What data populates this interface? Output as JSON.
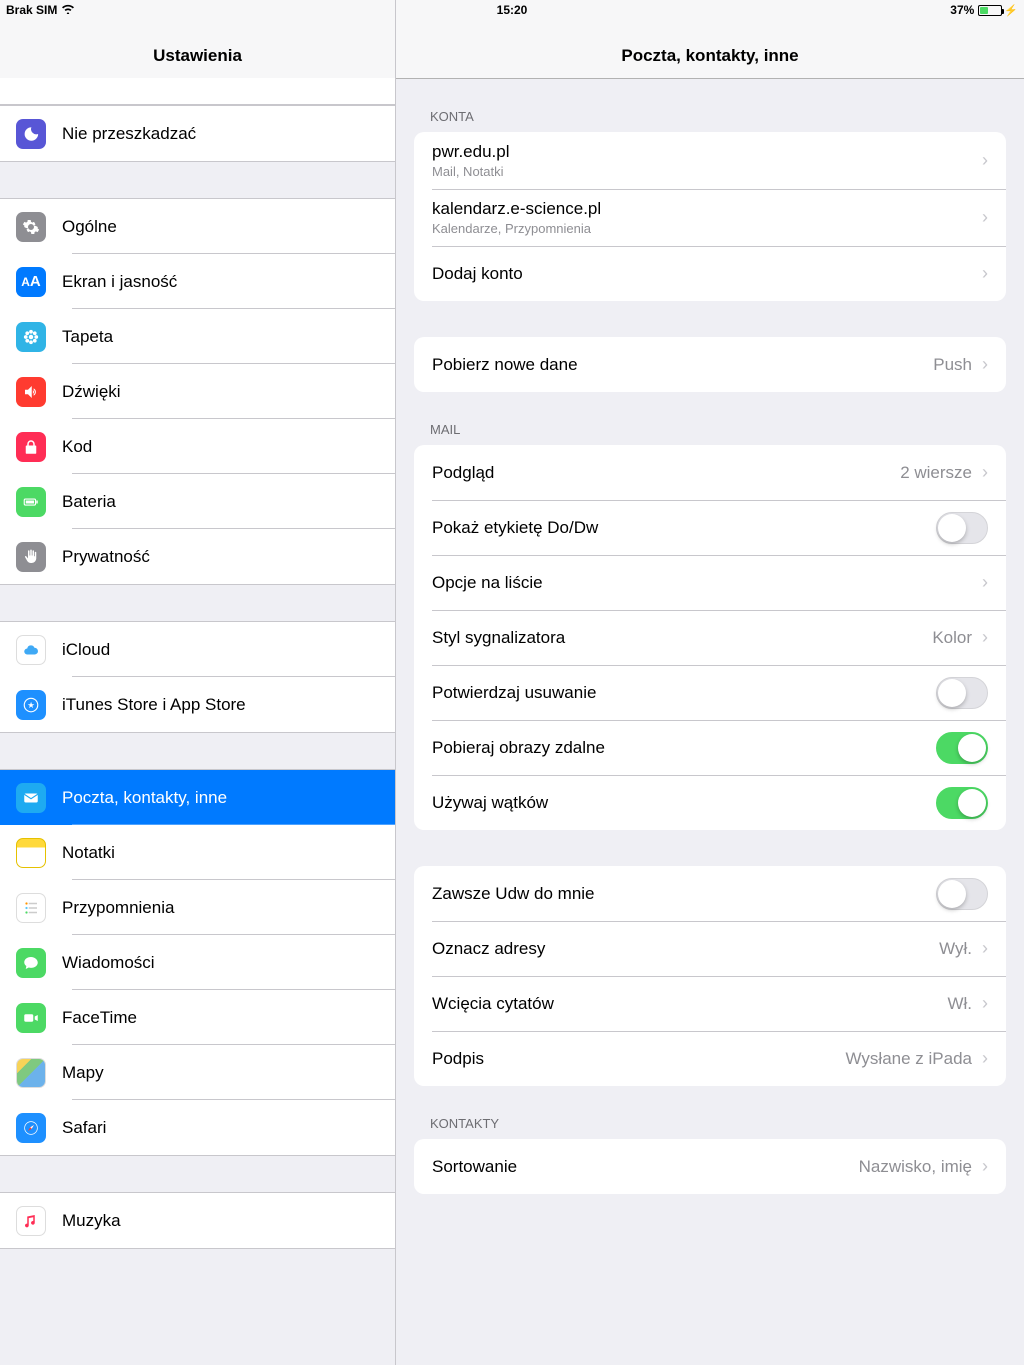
{
  "status": {
    "carrier": "Brak SIM",
    "time": "15:20",
    "battery_pct": "37%"
  },
  "sidebar": {
    "title": "Ustawienia",
    "items": [
      {
        "id": "dnd",
        "label": "Nie przeszkadzać",
        "icon": "moon",
        "bg": "#5856d6"
      },
      {
        "id": "general",
        "label": "Ogólne",
        "icon": "gear",
        "bg": "#8e8e93"
      },
      {
        "id": "display",
        "label": "Ekran i jasność",
        "icon": "AA",
        "bg": "#007aff"
      },
      {
        "id": "wallpaper",
        "label": "Tapeta",
        "icon": "flower",
        "bg": "#55c1ee"
      },
      {
        "id": "sounds",
        "label": "Dźwięki",
        "icon": "volume",
        "bg": "#ff3b30"
      },
      {
        "id": "passcode",
        "label": "Kod",
        "icon": "lock",
        "bg": "#ff2d55"
      },
      {
        "id": "battery",
        "label": "Bateria",
        "icon": "battery",
        "bg": "#4cd964"
      },
      {
        "id": "privacy",
        "label": "Prywatność",
        "icon": "hand",
        "bg": "#8e8e93"
      },
      {
        "id": "icloud",
        "label": "iCloud",
        "icon": "cloud",
        "bg": "#ffffff"
      },
      {
        "id": "itunes",
        "label": "iTunes Store i App Store",
        "icon": "appstore",
        "bg": "#1e90ff"
      },
      {
        "id": "mail",
        "label": "Poczta, kontakty, inne",
        "icon": "mail",
        "bg": "#1e90ff",
        "active": true
      },
      {
        "id": "notes",
        "label": "Notatki",
        "icon": "notes",
        "bg": "#ffcc00"
      },
      {
        "id": "reminders",
        "label": "Przypomnienia",
        "icon": "reminders",
        "bg": "#ffffff"
      },
      {
        "id": "messages",
        "label": "Wiadomości",
        "icon": "bubble",
        "bg": "#4cd964"
      },
      {
        "id": "facetime",
        "label": "FaceTime",
        "icon": "video",
        "bg": "#4cd964"
      },
      {
        "id": "maps",
        "label": "Mapy",
        "icon": "maps",
        "bg": "#ffffff"
      },
      {
        "id": "safari",
        "label": "Safari",
        "icon": "compass",
        "bg": "#1e90ff"
      },
      {
        "id": "music",
        "label": "Muzyka",
        "icon": "music",
        "bg": "#ffffff"
      }
    ]
  },
  "detail": {
    "title": "Poczta, kontakty, inne",
    "accounts_header": "Konta",
    "accounts": [
      {
        "title": "pwr.edu.pl",
        "sub": "Mail, Notatki"
      },
      {
        "title": "kalendarz.e-science.pl",
        "sub": "Kalendarze, Przypomnienia"
      }
    ],
    "add_account": "Dodaj konto",
    "fetch": {
      "label": "Pobierz nowe dane",
      "value": "Push"
    },
    "mail_header": "Mail",
    "mail": {
      "preview": {
        "label": "Podgląd",
        "value": "2 wiersze"
      },
      "show_tocc": {
        "label": "Pokaż etykietę Do/Dw",
        "on": false
      },
      "list_options": {
        "label": "Opcje na liście"
      },
      "flag_style": {
        "label": "Styl sygnalizatora",
        "value": "Kolor"
      },
      "ask_delete": {
        "label": "Potwierdzaj usuwanie",
        "on": false
      },
      "load_images": {
        "label": "Pobieraj obrazy zdalne",
        "on": true
      },
      "threads": {
        "label": "Używaj wątków",
        "on": true
      }
    },
    "mail2": {
      "always_bcc": {
        "label": "Zawsze Udw do mnie",
        "on": false
      },
      "mark_addresses": {
        "label": "Oznacz adresy",
        "value": "Wył."
      },
      "quote_indent": {
        "label": "Wcięcia cytatów",
        "value": "Wł."
      },
      "signature": {
        "label": "Podpis",
        "value": "Wysłane z iPada"
      }
    },
    "contacts_header": "Kontakty",
    "contacts": {
      "sort": {
        "label": "Sortowanie",
        "value": "Nazwisko, imię"
      }
    }
  }
}
